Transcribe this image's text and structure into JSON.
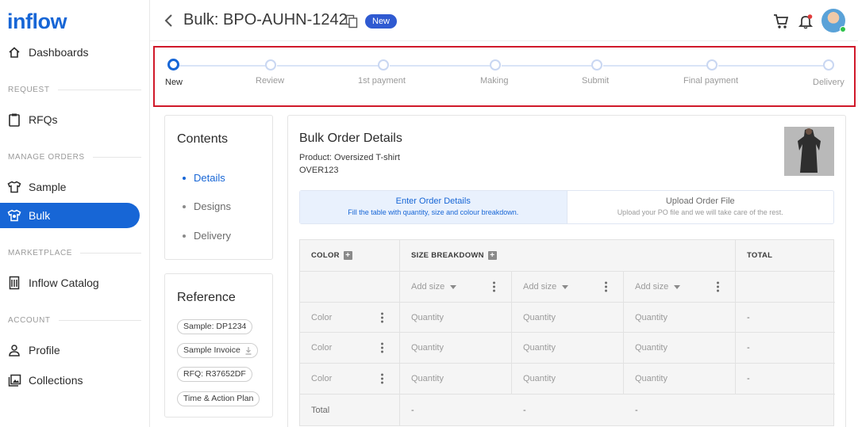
{
  "app": {
    "logo": "inflow"
  },
  "sidebar": {
    "items": [
      {
        "label": "Dashboards",
        "icon": "home-icon"
      },
      {
        "label": "RFQs",
        "icon": "clipboard-icon"
      },
      {
        "label": "Sample",
        "icon": "tshirt-icon"
      },
      {
        "label": "Bulk",
        "icon": "bulk-icon",
        "active": true
      },
      {
        "label": "Inflow Catalog",
        "icon": "catalog-icon"
      },
      {
        "label": "Profile",
        "icon": "person-icon"
      },
      {
        "label": "Collections",
        "icon": "gallery-icon"
      }
    ],
    "sections": [
      "REQUEST",
      "MANAGE ORDERS",
      "MARKETPLACE",
      "ACCOUNT"
    ]
  },
  "header": {
    "title": "Bulk: BPO-AUHN-1242",
    "badge": "New"
  },
  "stepper": {
    "steps": [
      "New",
      "Review",
      "1st payment",
      "Making",
      "Submit",
      "Final payment",
      "Delivery"
    ],
    "current": 0
  },
  "contents": {
    "title": "Contents",
    "items": [
      "Details",
      "Designs",
      "Delivery"
    ]
  },
  "reference": {
    "title": "Reference",
    "chips": [
      "Sample: DP1234",
      "Sample Invoice",
      "RFQ: R37652DF",
      "Time & Action Plan"
    ]
  },
  "details": {
    "title": "Bulk Order Details",
    "product": "Product: Oversized T-shirt",
    "code": "OVER123"
  },
  "tabs": [
    {
      "title": "Enter Order Details",
      "subtitle": "Fill the table with quantity, size and colour breakdown."
    },
    {
      "title": "Upload Order File",
      "subtitle": "Upload your PO file and we will take care of the rest."
    }
  ],
  "table": {
    "headers": {
      "color": "COLOR",
      "size": "SIZE BREAKDOWN",
      "total": "TOTAL"
    },
    "add_size": "Add size",
    "rows": [
      {
        "color": "Color",
        "q": [
          "Quantity",
          "Quantity",
          "Quantity"
        ],
        "total": "-"
      },
      {
        "color": "Color",
        "q": [
          "Quantity",
          "Quantity",
          "Quantity"
        ],
        "total": "-"
      },
      {
        "color": "Color",
        "q": [
          "Quantity",
          "Quantity",
          "Quantity"
        ],
        "total": "-"
      }
    ],
    "footer": {
      "label": "Total",
      "values": [
        "-",
        "-",
        "-"
      ]
    }
  },
  "colors": {
    "accent": "#1766d6",
    "badge": "#2f5ad1",
    "highlight_border": "#d0192a"
  }
}
